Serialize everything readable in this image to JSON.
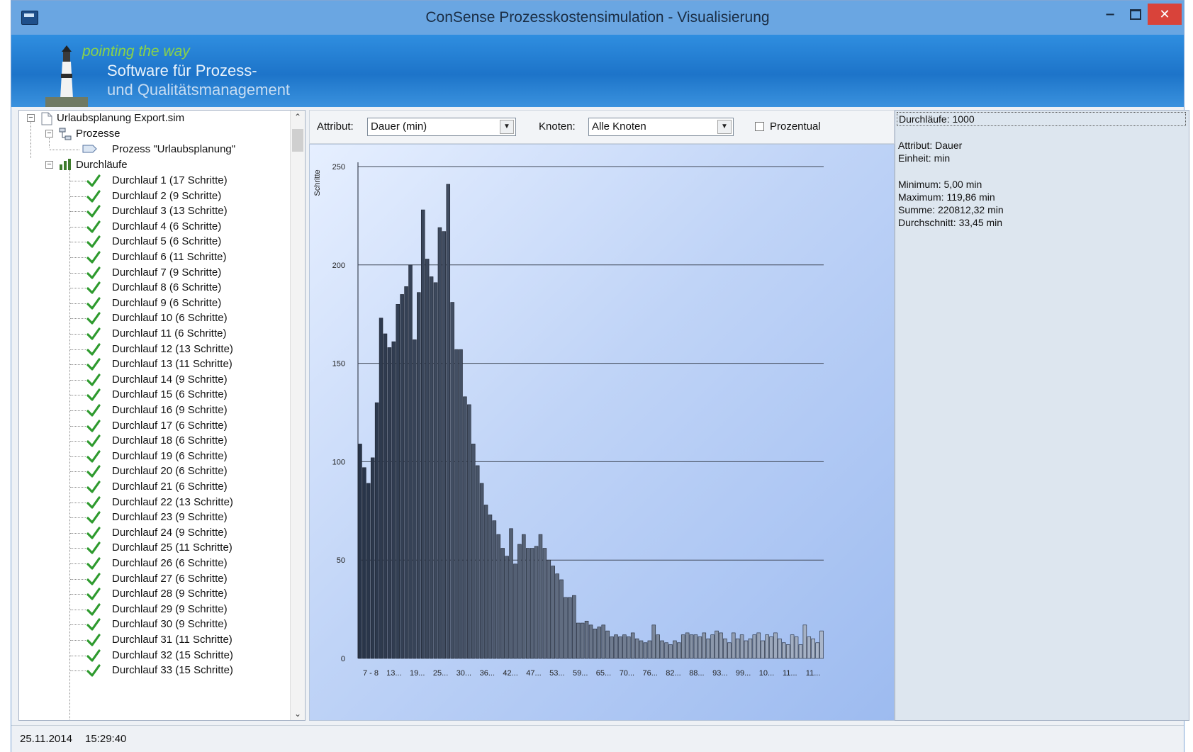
{
  "window": {
    "title": "ConSense Prozesskostensimulation - Visualisierung",
    "minimize": "−",
    "close": "✕"
  },
  "banner": {
    "tagline": "pointing the way",
    "line1": "Software für Prozess-",
    "line2": "und Qualitätsmanagement"
  },
  "tree": {
    "root": "Urlaubsplanung Export.sim",
    "processes_folder": "Prozesse",
    "process_item": "Prozess \"Urlaubsplanung\"",
    "runs_folder": "Durchläufe",
    "runs": [
      "Durchlauf 1 (17 Schritte)",
      "Durchlauf 2 (9 Schritte)",
      "Durchlauf 3 (13 Schritte)",
      "Durchlauf 4 (6 Schritte)",
      "Durchlauf 5 (6 Schritte)",
      "Durchlauf 6 (11 Schritte)",
      "Durchlauf 7 (9 Schritte)",
      "Durchlauf 8 (6 Schritte)",
      "Durchlauf 9 (6 Schritte)",
      "Durchlauf 10 (6 Schritte)",
      "Durchlauf 11 (6 Schritte)",
      "Durchlauf 12 (13 Schritte)",
      "Durchlauf 13 (11 Schritte)",
      "Durchlauf 14 (9 Schritte)",
      "Durchlauf 15 (6 Schritte)",
      "Durchlauf 16 (9 Schritte)",
      "Durchlauf 17 (6 Schritte)",
      "Durchlauf 18 (6 Schritte)",
      "Durchlauf 19 (6 Schritte)",
      "Durchlauf 20 (6 Schritte)",
      "Durchlauf 21 (6 Schritte)",
      "Durchlauf 22 (13 Schritte)",
      "Durchlauf 23 (9 Schritte)",
      "Durchlauf 24 (9 Schritte)",
      "Durchlauf 25 (11 Schritte)",
      "Durchlauf 26 (6 Schritte)",
      "Durchlauf 27 (6 Schritte)",
      "Durchlauf 28 (9 Schritte)",
      "Durchlauf 29 (9 Schritte)",
      "Durchlauf 30 (9 Schritte)",
      "Durchlauf 31 (11 Schritte)",
      "Durchlauf 32 (15 Schritte)",
      "Durchlauf 33 (15 Schritte)"
    ]
  },
  "toolbar": {
    "attribute_label": "Attribut:",
    "attribute_value": "Dauer (min)",
    "node_label": "Knoten:",
    "node_value": "Alle Knoten",
    "percent_label": "Prozentual",
    "percent_checked": false
  },
  "info": {
    "runs": "Durchläufe: 1000",
    "attribute": "Attribut: Dauer",
    "unit": "Einheit: min",
    "minimum": "Minimum: 5,00 min",
    "maximum": "Maximum: 119,86 min",
    "sum": "Summe: 220812,32 min",
    "average": "Durchschnitt: 33,45 min"
  },
  "status": {
    "date": "25.11.2014",
    "time": "15:29:40"
  },
  "chart_data": {
    "type": "bar",
    "ylabel": "Schritte",
    "ylim": [
      0,
      250
    ],
    "yticks": [
      0,
      50,
      100,
      150,
      200,
      250
    ],
    "grid": true,
    "xtick_labels": [
      "7 - 8",
      "13...",
      "19...",
      "25...",
      "30...",
      "36...",
      "42...",
      "47...",
      "53...",
      "59...",
      "65...",
      "70...",
      "76...",
      "82...",
      "88...",
      "93...",
      "99...",
      "10...",
      "11...",
      "11..."
    ],
    "values": [
      109,
      97,
      89,
      102,
      130,
      173,
      165,
      158,
      161,
      180,
      185,
      189,
      200,
      162,
      186,
      228,
      203,
      194,
      191,
      219,
      217,
      241,
      181,
      157,
      157,
      133,
      129,
      109,
      98,
      89,
      78,
      73,
      70,
      63,
      56,
      52,
      66,
      48,
      58,
      63,
      56,
      56,
      57,
      63,
      56,
      50,
      47,
      43,
      40,
      31,
      31,
      32,
      18,
      18,
      19,
      17,
      15,
      16,
      17,
      14,
      11,
      12,
      11,
      12,
      11,
      13,
      10,
      9,
      8,
      9,
      17,
      12,
      9,
      8,
      7,
      9,
      8,
      12,
      13,
      12,
      12,
      11,
      13,
      10,
      12,
      14,
      13,
      10,
      8,
      13,
      10,
      12,
      9,
      10,
      12,
      13,
      9,
      12,
      11,
      13,
      10,
      8,
      7,
      12,
      11,
      7,
      17,
      11,
      10,
      8,
      14
    ]
  }
}
